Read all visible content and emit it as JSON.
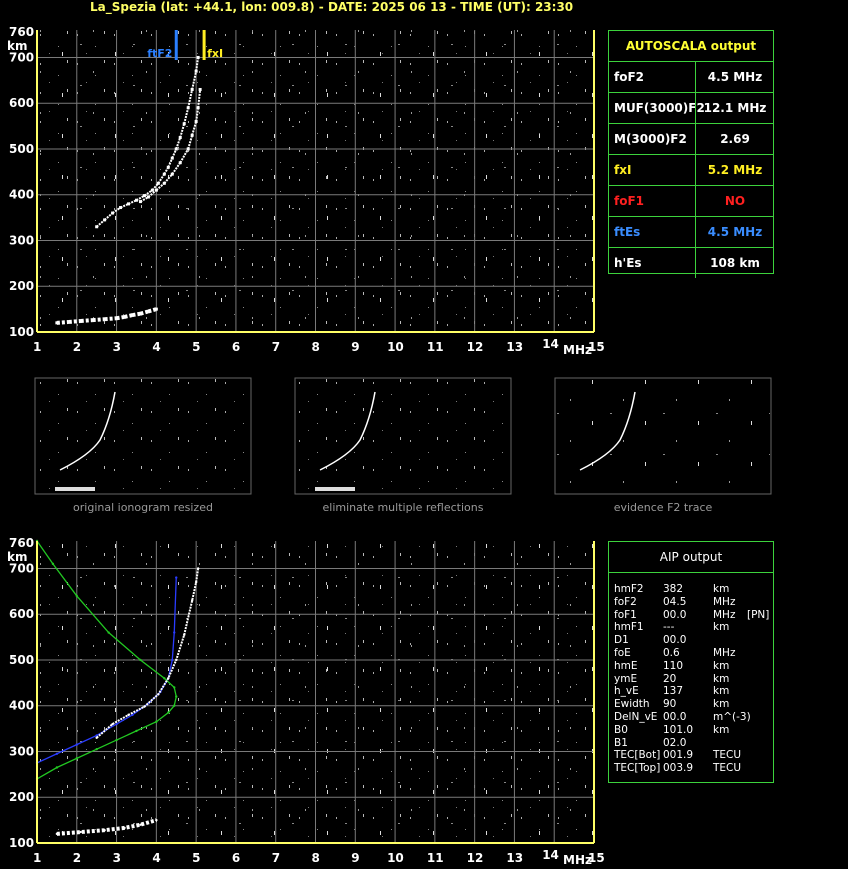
{
  "title": "La_Spezia (lat: +44.1, lon: 009.8) - DATE: 2025 06 13 - TIME (UT): 23:30",
  "axes": {
    "y_unit": "km",
    "x_unit": "MHz",
    "y_ticks": [
      "760",
      "700",
      "600",
      "500",
      "400",
      "300",
      "200",
      "100"
    ],
    "x_ticks": [
      "1",
      "2",
      "3",
      "4",
      "5",
      "6",
      "7",
      "8",
      "9",
      "10",
      "11",
      "12",
      "13",
      "14",
      "15"
    ]
  },
  "markers": {
    "ftF2_label": "ftF2",
    "fxI_label": "fxI",
    "ftF2_color": "#2a7fff",
    "fxI_color": "#ffee22"
  },
  "autoscala": {
    "header": "AUTOSCALA output",
    "rows": [
      {
        "key": "foF2",
        "value": "4.5 MHz",
        "key_color": "#ffffff",
        "value_color": "#ffffff"
      },
      {
        "key": "MUF(3000)F2",
        "value": "12.1 MHz",
        "key_color": "#ffffff",
        "value_color": "#ffffff"
      },
      {
        "key": "M(3000)F2",
        "value": "2.69",
        "key_color": "#ffffff",
        "value_color": "#ffffff"
      },
      {
        "key": "fxI",
        "value": "5.2 MHz",
        "key_color": "#ffee22",
        "value_color": "#ffee22"
      },
      {
        "key": "foF1",
        "value": "NO",
        "key_color": "#ff2020",
        "value_color": "#ff2020"
      },
      {
        "key": "ftEs",
        "value": "4.5 MHz",
        "key_color": "#3a8dff",
        "value_color": "#3a8dff"
      },
      {
        "key": "h'Es",
        "value": "108     km",
        "key_color": "#ffffff",
        "value_color": "#ffffff"
      }
    ]
  },
  "thumbnails": [
    {
      "caption": "original ionogram resized"
    },
    {
      "caption": "eliminate multiple reflections"
    },
    {
      "caption": "evidence F2 trace"
    }
  ],
  "aip": {
    "header": "AIP output",
    "rows": [
      {
        "k": "hmF2",
        "v": "382",
        "u": "km",
        "x": ""
      },
      {
        "k": "foF2",
        "v": "04.5",
        "u": "MHz",
        "x": ""
      },
      {
        "k": "foF1",
        "v": "00.0",
        "u": "MHz",
        "x": "[PN]"
      },
      {
        "k": "hmF1",
        "v": "---",
        "u": "km",
        "x": ""
      },
      {
        "k": "D1",
        "v": "00.0",
        "u": "",
        "x": ""
      },
      {
        "k": "foE",
        "v": "0.6",
        "u": "MHz",
        "x": ""
      },
      {
        "k": "hmE",
        "v": "110",
        "u": "km",
        "x": ""
      },
      {
        "k": "ymE",
        "v": "20",
        "u": "km",
        "x": ""
      },
      {
        "k": "h_vE",
        "v": "137",
        "u": "km",
        "x": ""
      },
      {
        "k": "Ewidth",
        "v": "90",
        "u": "km",
        "x": ""
      },
      {
        "k": "DelN_vE",
        "v": "00.0",
        "u": "m^(-3)",
        "x": ""
      },
      {
        "k": "B0",
        "v": "101.0",
        "u": "km",
        "x": ""
      },
      {
        "k": "B1",
        "v": "02.0",
        "u": "",
        "x": ""
      },
      {
        "k": "TEC[Bot]",
        "v": "001.9",
        "u": "TECU",
        "x": ""
      },
      {
        "k": "TEC[Top]",
        "v": "003.9",
        "u": "TECU",
        "x": ""
      }
    ]
  },
  "chart_data": [
    {
      "type": "scatter",
      "title": "",
      "xlabel": "MHz",
      "ylabel": "km",
      "xlim": [
        1,
        15
      ],
      "ylim": [
        100,
        760
      ],
      "grid": true,
      "series": [
        {
          "name": "",
          "color": "#ffffff",
          "x": [
            2.5,
            2.7,
            2.9,
            3.1,
            3.3,
            3.5,
            3.7,
            3.9,
            4.05,
            4.2,
            4.3,
            4.4,
            4.5,
            4.6,
            4.7,
            4.8,
            4.9,
            5.0,
            5.05
          ],
          "y": [
            330,
            345,
            360,
            372,
            380,
            388,
            398,
            410,
            425,
            445,
            460,
            480,
            500,
            525,
            555,
            590,
            630,
            670,
            700
          ]
        },
        {
          "name": "",
          "color": "#ffffff",
          "x": [
            3.6,
            3.8,
            4.0,
            4.2,
            4.4,
            4.6,
            4.8,
            4.9,
            5.0,
            5.05,
            5.1
          ],
          "y": [
            385,
            395,
            410,
            425,
            445,
            470,
            500,
            530,
            560,
            590,
            630
          ]
        },
        {
          "name": "",
          "color": "#ffffff",
          "x": [
            1.5,
            1.8,
            2.1,
            2.4,
            2.7,
            3.0,
            3.2,
            3.4,
            3.6,
            3.8,
            4.0
          ],
          "y": [
            120,
            122,
            124,
            126,
            128,
            130,
            133,
            137,
            140,
            145,
            150
          ]
        }
      ],
      "markers": [
        {
          "name": "ftF2",
          "x": 4.5,
          "color": "#2a7fff"
        },
        {
          "name": "fxI",
          "x": 5.2,
          "color": "#ffee22"
        }
      ]
    },
    {
      "type": "line",
      "title": "",
      "xlabel": "MHz",
      "ylabel": "km",
      "xlim": [
        1,
        15
      ],
      "ylim": [
        100,
        760
      ],
      "grid": true,
      "series": [
        {
          "name": "",
          "color": "#2a3cff",
          "x": [
            1.0,
            1.5,
            2.0,
            2.5,
            3.0,
            3.4,
            3.8,
            4.1,
            4.3,
            4.4,
            4.45,
            4.5
          ],
          "y": [
            275,
            295,
            315,
            335,
            360,
            380,
            405,
            430,
            460,
            500,
            560,
            680
          ]
        },
        {
          "name": "",
          "color": "#22c822",
          "x": [
            1.0,
            1.5,
            2.0,
            2.5,
            3.0,
            3.5,
            4.0,
            4.3,
            4.45,
            4.5,
            4.45,
            4.2,
            3.6,
            2.8,
            2.0,
            1.4,
            1.0
          ],
          "y": [
            240,
            265,
            285,
            305,
            325,
            345,
            365,
            385,
            400,
            420,
            440,
            460,
            500,
            560,
            640,
            710,
            760
          ]
        },
        {
          "name": "",
          "color": "#ffffff",
          "x": [
            2.5,
            2.9,
            3.3,
            3.7,
            4.05,
            4.3,
            4.5,
            4.7,
            4.9,
            5.0,
            5.05
          ],
          "y": [
            330,
            360,
            380,
            398,
            425,
            460,
            500,
            555,
            630,
            670,
            700
          ]
        },
        {
          "name": "",
          "color": "#ffffff",
          "x": [
            1.5,
            2.1,
            2.7,
            3.2,
            3.6,
            4.0
          ],
          "y": [
            120,
            124,
            128,
            133,
            140,
            150
          ]
        }
      ]
    }
  ]
}
